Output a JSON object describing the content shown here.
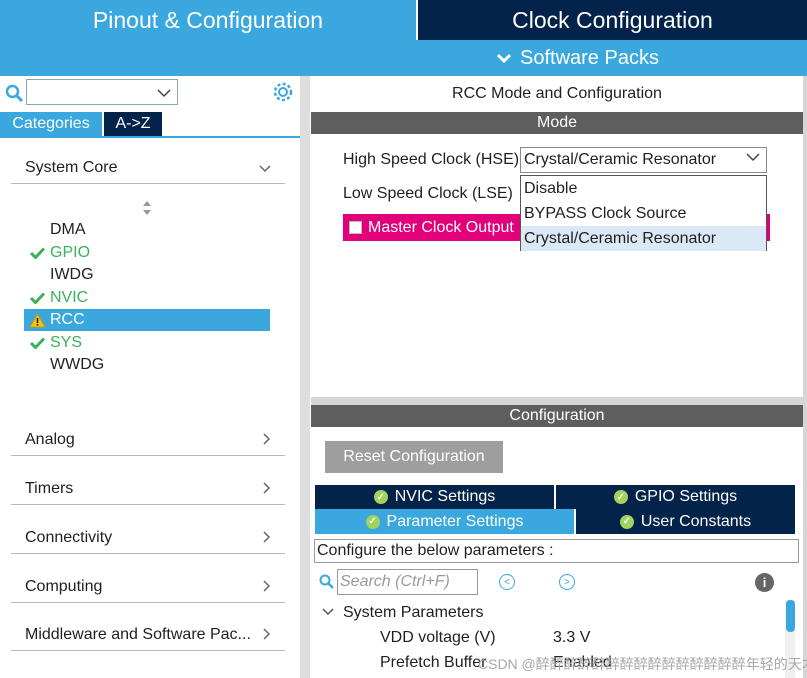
{
  "top_tabs": {
    "pinout": "Pinout & Configuration",
    "clock": "Clock Configuration",
    "software_packs": "Software Packs"
  },
  "left": {
    "search_value": "",
    "tabs": [
      "Categories",
      "A->Z"
    ],
    "sections": {
      "system_core": "System Core",
      "analog": "Analog",
      "timers": "Timers",
      "connectivity": "Connectivity",
      "computing": "Computing",
      "middleware": "Middleware and Software Pac..."
    },
    "peripherals": [
      {
        "label": "DMA",
        "status": "none"
      },
      {
        "label": "GPIO",
        "status": "ok"
      },
      {
        "label": "IWDG",
        "status": "none"
      },
      {
        "label": "NVIC",
        "status": "ok"
      },
      {
        "label": "RCC",
        "status": "warning"
      },
      {
        "label": "SYS",
        "status": "ok"
      },
      {
        "label": "WWDG",
        "status": "none"
      }
    ]
  },
  "mode": {
    "title": "RCC Mode and Configuration",
    "bar": "Mode",
    "hse_label": "High Speed Clock (HSE)",
    "hse_value": "Crystal/Ceramic Resonator",
    "lse_label": "Low Speed Clock (LSE)",
    "mco_label": "Master Clock Output",
    "dropdown_options": [
      "Disable",
      "BYPASS Clock Source",
      "Crystal/Ceramic Resonator"
    ]
  },
  "configuration": {
    "bar": "Configuration",
    "reset_button": "Reset Configuration",
    "tabs": {
      "nvic": "NVIC Settings",
      "gpio": "GPIO Settings",
      "parameter": "Parameter Settings",
      "user": "User Constants"
    },
    "caption": "Configure the below parameters :",
    "search_placeholder": "Search (Ctrl+F)",
    "group": "System Parameters",
    "params": [
      {
        "name": "VDD voltage (V)",
        "value": "3.3 V"
      },
      {
        "name": "Prefetch Buffer",
        "value": "Enabled"
      }
    ]
  },
  "watermark": "CSDN @醉醉醉醉醉醉醉醉醉醉醉醉醉醉醉年轻的天才",
  "colors": {
    "accent": "#3aa8df",
    "dark": "#03234b",
    "mco": "#e1007a",
    "ok": "#3bb15b"
  }
}
